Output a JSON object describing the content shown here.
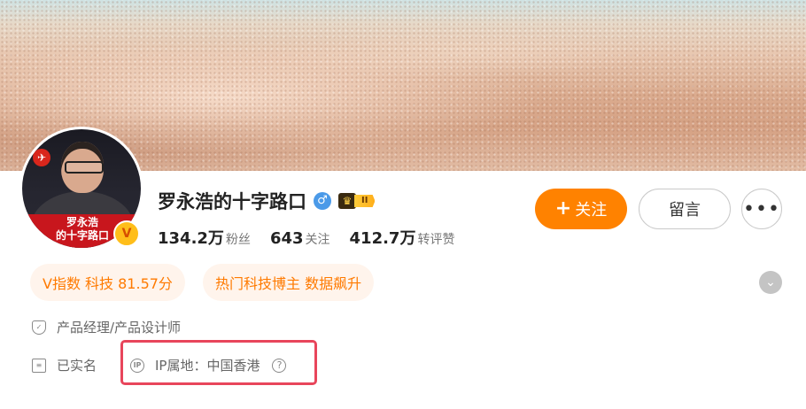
{
  "profile": {
    "name": "罗永浩的十字路口",
    "gender_icon": "male-icon",
    "level_label": "II",
    "verified_mark": "V",
    "avatar_text": "罗永浩\n的十字路口"
  },
  "stats": [
    {
      "value": "134.2万",
      "label": "粉丝"
    },
    {
      "value": "643",
      "label": "关注"
    },
    {
      "value": "412.7万",
      "label": "转评赞"
    }
  ],
  "actions": {
    "follow_plus": "+",
    "follow_label": "关注",
    "message_label": "留言",
    "more_label": "•••"
  },
  "tags": [
    {
      "text": "V指数 科技 81.57分"
    },
    {
      "text": "热门科技博主 数据飙升"
    }
  ],
  "info": {
    "job": "产品经理/产品设计师",
    "real_name": "已实名",
    "ip": "IP属地：中国香港"
  },
  "colors": {
    "accent": "#ff8200",
    "tag_text": "#ff7a00",
    "tag_bg": "#fff4ec",
    "highlight": "#e8455b"
  }
}
